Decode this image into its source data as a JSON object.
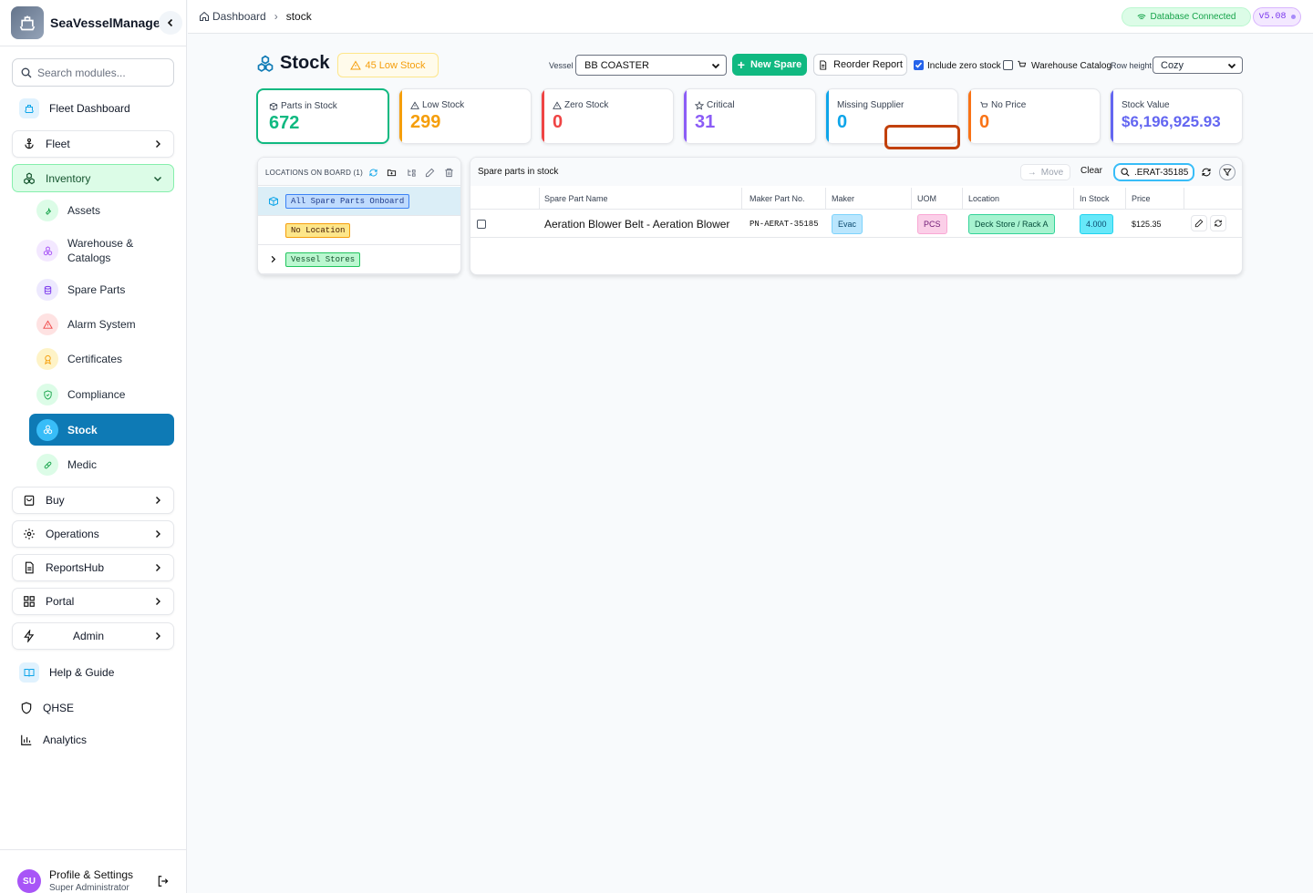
{
  "app": {
    "name": "SeaVesselManager"
  },
  "sidebar": {
    "search_placeholder": "Search modules...",
    "items": [
      {
        "label": "Fleet Dashboard",
        "icon": "ship-icon"
      },
      {
        "label": "Fleet",
        "icon": "anchor-icon"
      },
      {
        "label": "Inventory",
        "icon": "cubes-icon"
      },
      {
        "label": "Buy",
        "icon": "bag-icon"
      },
      {
        "label": "Operations",
        "icon": "gear-icon"
      },
      {
        "label": "ReportsHub",
        "icon": "document-icon"
      },
      {
        "label": "Portal",
        "icon": "grid-icon"
      },
      {
        "label": "Admin",
        "icon": "bolt-icon"
      },
      {
        "label": "Help & Guide",
        "icon": "book-icon"
      },
      {
        "label": "QHSE",
        "icon": "shield-icon"
      },
      {
        "label": "Analytics",
        "icon": "bar-chart-icon"
      }
    ],
    "inventory_sub": [
      {
        "label": "Assets"
      },
      {
        "label": "Warehouse & Catalogs"
      },
      {
        "label": "Spare Parts"
      },
      {
        "label": "Alarm System"
      },
      {
        "label": "Certificates"
      },
      {
        "label": "Compliance"
      },
      {
        "label": "Stock"
      },
      {
        "label": "Medic"
      }
    ],
    "profile": {
      "initials": "SU",
      "name": "Profile & Settings",
      "role": "Super Administrator"
    }
  },
  "topbar": {
    "breadcrumb_home": "Dashboard",
    "breadcrumb_current": "stock",
    "db_status": "Database Connected",
    "version": "v5.08"
  },
  "page": {
    "title": "Stock",
    "low_stock_badge": "45 Low Stock",
    "vessel_label": "Vessel",
    "vessel_value": "BB COASTER",
    "new_spare": "New Spare",
    "reorder_report": "Reorder Report",
    "include_zero_stock": "Include zero stock",
    "warehouse_catalog": "Warehouse Catalog",
    "row_height_label": "Row height",
    "row_height_value": "Cozy"
  },
  "stats": [
    {
      "title": "Parts in Stock",
      "value": "672",
      "color": "#10b981"
    },
    {
      "title": "Low Stock",
      "value": "299",
      "color": "#f59e0b"
    },
    {
      "title": "Zero Stock",
      "value": "0",
      "color": "#ef4444"
    },
    {
      "title": "Critical",
      "value": "31",
      "color": "#8b5cf6"
    },
    {
      "title": "Missing Supplier",
      "value": "0",
      "color": "#0ea5e9"
    },
    {
      "title": "No Price",
      "value": "0",
      "color": "#f97316"
    },
    {
      "title": "Stock Value",
      "value": "$6,196,925.93",
      "color": "#6366f1"
    }
  ],
  "locations": {
    "title": "LOCATIONS ON BOARD (1)",
    "rows": [
      {
        "label": "All Spare Parts Onboard"
      },
      {
        "label": "No Location"
      },
      {
        "label": "Vessel Stores"
      }
    ]
  },
  "parts": {
    "title": "Spare parts in stock",
    "move": "Move",
    "clear": "Clear",
    "search_value": ".ERAT-35185",
    "columns": [
      "Spare Part Name",
      "Maker Part No.",
      "Maker",
      "UOM",
      "Location",
      "In Stock",
      "Price"
    ],
    "rows": [
      {
        "name": "Aeration Blower Belt - Aeration Blower",
        "part_no": "PN-AERAT-35185",
        "maker": "Evac",
        "uom": "PCS",
        "location": "Deck Store / Rack A",
        "in_stock": "4.000",
        "price": "$125.35"
      }
    ]
  }
}
